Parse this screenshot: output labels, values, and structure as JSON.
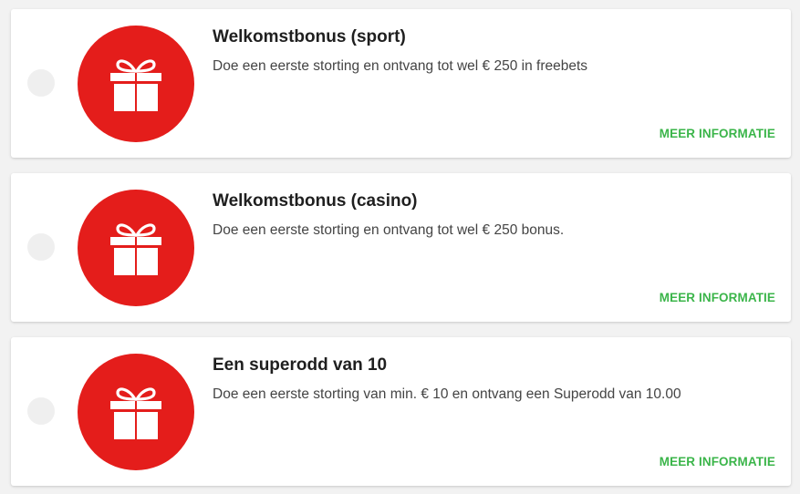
{
  "theme": {
    "accent_red": "#e41d1b",
    "link_green": "#3bb54a"
  },
  "icon": "gift-icon",
  "bonuses": [
    {
      "title": "Welkomstbonus (sport)",
      "description": "Doe een eerste storting en ontvang tot wel € 250 in freebets",
      "link": "MEER INFORMATIE"
    },
    {
      "title": "Welkomstbonus (casino)",
      "description": "Doe een eerste storting en ontvang tot wel € 250 bonus.",
      "link": "MEER INFORMATIE"
    },
    {
      "title": "Een superodd van 10",
      "description": "Doe een eerste storting van min. € 10 en ontvang een Superodd van 10.00",
      "link": "MEER INFORMATIE"
    }
  ]
}
